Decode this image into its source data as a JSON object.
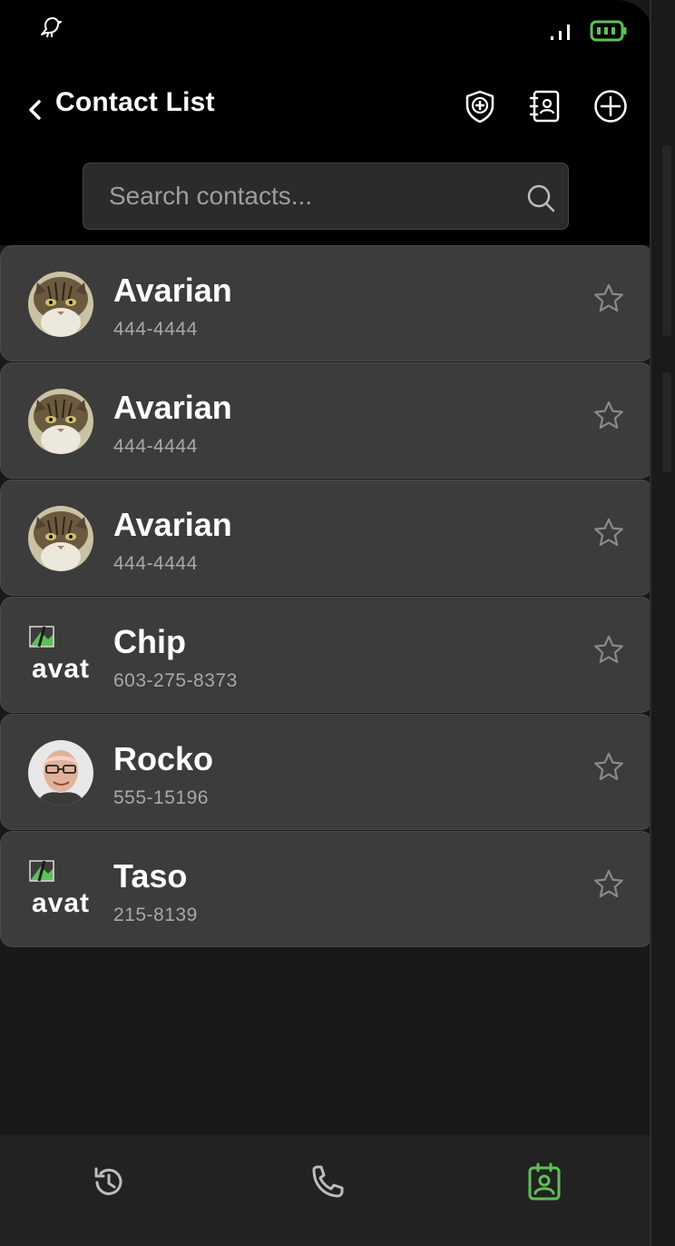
{
  "header": {
    "title": "Contact List"
  },
  "search": {
    "placeholder": "Search contacts..."
  },
  "contacts": [
    {
      "name": "Avarian",
      "phone": "444-4444",
      "avatar": "cat-photo",
      "favorite": false
    },
    {
      "name": "Avarian",
      "phone": "444-4444",
      "avatar": "cat-photo",
      "favorite": false
    },
    {
      "name": "Avarian",
      "phone": "444-4444",
      "avatar": "cat-photo",
      "favorite": false
    },
    {
      "name": "Chip",
      "phone": "603-275-8373",
      "avatar": "broken-image",
      "avatar_alt": "avat",
      "favorite": false
    },
    {
      "name": "Rocko",
      "phone": "555-15196",
      "avatar": "person-photo",
      "favorite": false
    },
    {
      "name": "Taso",
      "phone": "215-8139",
      "avatar": "broken-image",
      "avatar_alt": "avat",
      "favorite": false
    }
  ],
  "icons": {
    "status": [
      "bird-icon",
      "signal-icon",
      "battery-icon"
    ],
    "header": [
      "back-chevron-icon",
      "shield-plus-icon",
      "contact-book-icon",
      "add-circle-icon"
    ],
    "nav": [
      "history-icon",
      "phone-icon",
      "contacts-icon"
    ]
  },
  "colors": {
    "accent": "#5fbf5a",
    "background": "#000000",
    "row": "#3c3c3c"
  }
}
